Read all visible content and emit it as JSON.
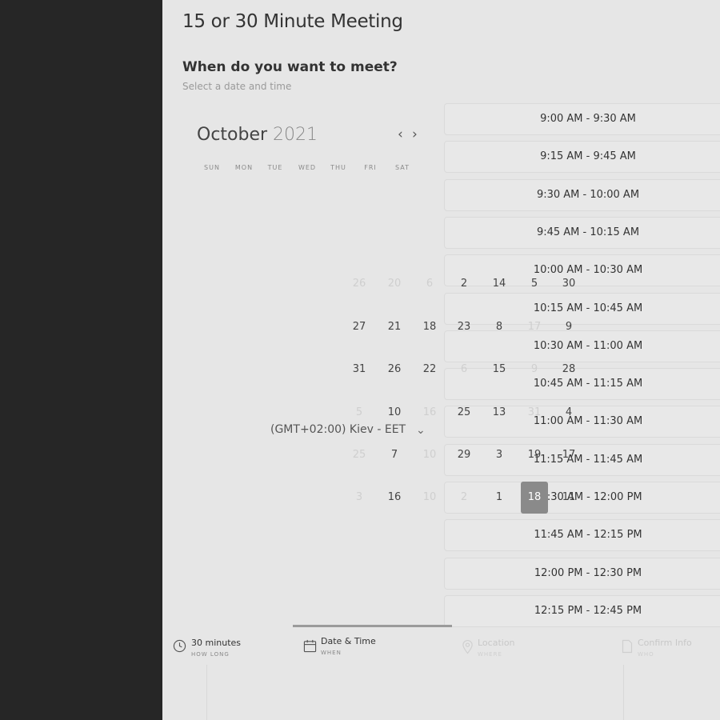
{
  "event": {
    "title": "15 or 30 Minute Meeting",
    "prompt": "When do you want to meet?",
    "hint": "Select a date and time"
  },
  "calendar": {
    "month": "October",
    "year": "2021",
    "prev_icon": "chevron-left-icon",
    "next_icon": "chevron-right-icon",
    "weekdays": [
      "SUN",
      "MON",
      "TUE",
      "WED",
      "THU",
      "FRI",
      "SAT"
    ],
    "days": [
      {
        "label": "26",
        "dim": true
      },
      {
        "label": "20",
        "dim": true
      },
      {
        "label": "6",
        "dim": true
      },
      {
        "label": "2",
        "dim": false
      },
      {
        "label": "14",
        "dim": false
      },
      {
        "label": "5",
        "dim": false
      },
      {
        "label": "30",
        "dim": false
      },
      {
        "label": "27",
        "dim": false
      },
      {
        "label": "21",
        "dim": false
      },
      {
        "label": "18",
        "dim": false
      },
      {
        "label": "23",
        "dim": false
      },
      {
        "label": "8",
        "dim": false
      },
      {
        "label": "17",
        "dim": true
      },
      {
        "label": "9",
        "dim": false
      },
      {
        "label": "31",
        "dim": false
      },
      {
        "label": "26",
        "dim": false
      },
      {
        "label": "22",
        "dim": false
      },
      {
        "label": "6",
        "dim": true
      },
      {
        "label": "15",
        "dim": false
      },
      {
        "label": "9",
        "dim": true
      },
      {
        "label": "28",
        "dim": false
      },
      {
        "label": "5",
        "dim": true
      },
      {
        "label": "10",
        "dim": false
      },
      {
        "label": "16",
        "dim": true
      },
      {
        "label": "25",
        "dim": false
      },
      {
        "label": "13",
        "dim": false
      },
      {
        "label": "31",
        "dim": true
      },
      {
        "label": "4",
        "dim": false
      },
      {
        "label": "25",
        "dim": true
      },
      {
        "label": "7",
        "dim": false
      },
      {
        "label": "10",
        "dim": true
      },
      {
        "label": "29",
        "dim": false
      },
      {
        "label": "3",
        "dim": false
      },
      {
        "label": "19",
        "dim": false
      },
      {
        "label": "17",
        "dim": false
      },
      {
        "label": "3",
        "dim": true
      },
      {
        "label": "16",
        "dim": false
      },
      {
        "label": "10",
        "dim": true
      },
      {
        "label": "2",
        "dim": true
      },
      {
        "label": "1",
        "dim": false
      },
      {
        "label": "18",
        "dim": false,
        "selected": true
      },
      {
        "label": "11",
        "dim": false
      }
    ],
    "timezone": "(GMT+02:00) Kiev - EET"
  },
  "time_slots": [
    "9:00 AM - 9:30 AM",
    "9:15 AM - 9:45 AM",
    "9:30 AM - 10:00 AM",
    "9:45 AM - 10:15 AM",
    "10:00 AM - 10:30 AM",
    "10:15 AM - 10:45 AM",
    "10:30 AM - 11:00 AM",
    "10:45 AM - 11:15 AM",
    "11:00 AM - 11:30 AM",
    "11:15 AM - 11:45 AM",
    "11:30 AM - 12:00 PM",
    "11:45 AM - 12:15 PM",
    "12:00 PM - 12:30 PM",
    "12:15 PM - 12:45 PM"
  ],
  "steps": [
    {
      "label": "30 minutes",
      "sub": "HOW LONG",
      "icon": "clock-icon",
      "state": "done"
    },
    {
      "label": "Date & Time",
      "sub": "WHEN",
      "icon": "calendar-icon",
      "state": "active"
    },
    {
      "label": "Location",
      "sub": "WHERE",
      "icon": "location-pin-icon",
      "state": "pending"
    },
    {
      "label": "Confirm Info",
      "sub": "WHO",
      "icon": "document-icon",
      "state": "pending"
    }
  ]
}
